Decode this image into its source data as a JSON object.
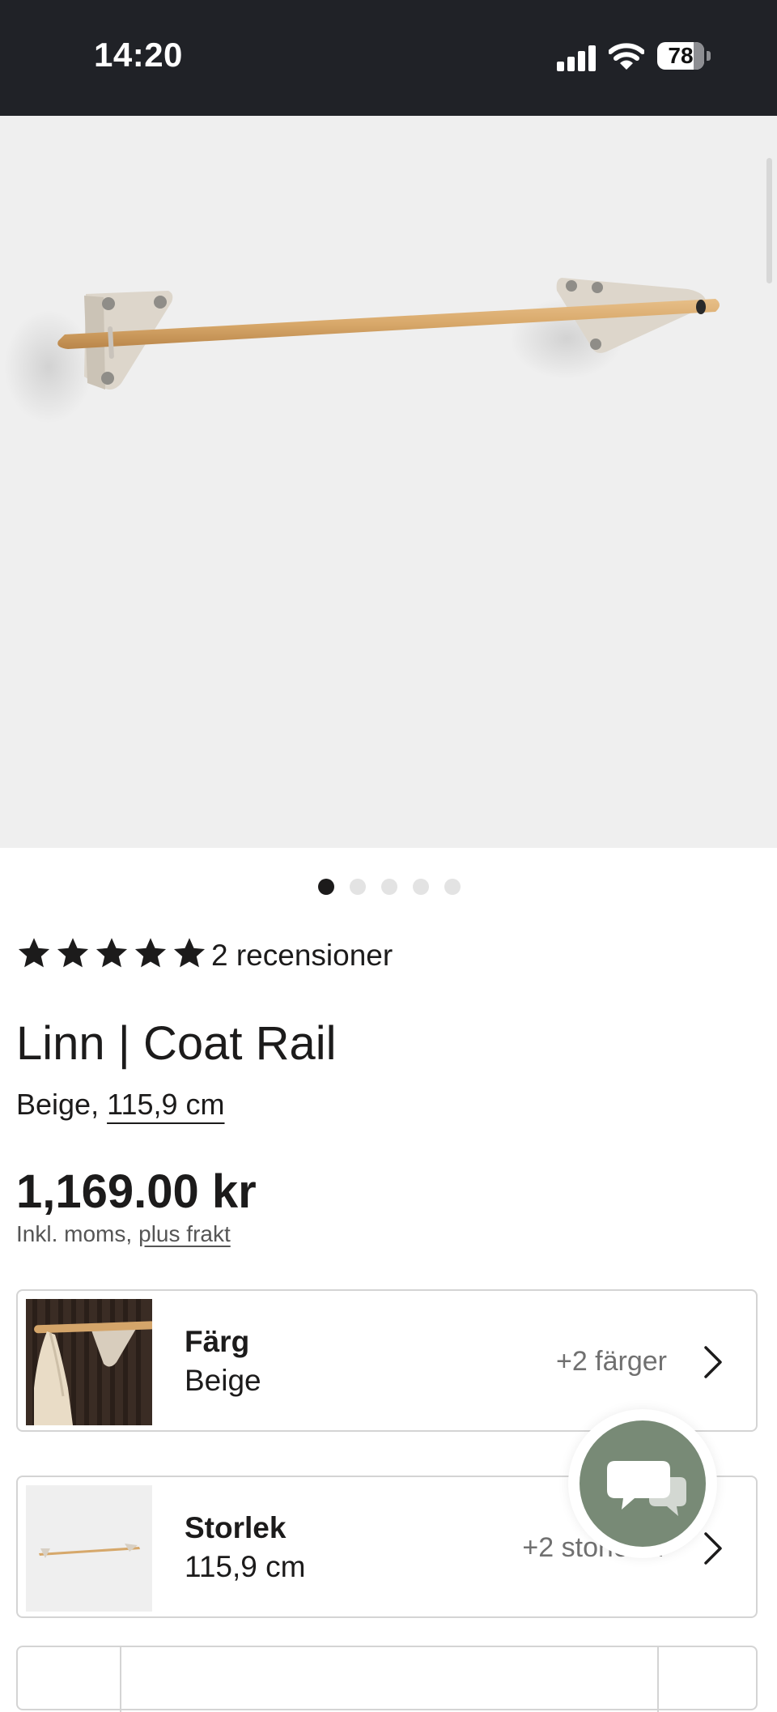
{
  "status_bar": {
    "time": "14:20",
    "battery": "78",
    "battery_level": 0.78
  },
  "gallery": {
    "image_count": 5,
    "active_index": 0
  },
  "product": {
    "rating": {
      "stars": 5,
      "reviews_label": "2 recensioner"
    },
    "title": "Linn | Coat Rail",
    "color_prefix": "Beige,",
    "size": "115,9 cm",
    "price": "1,169.00 kr",
    "price_note": "Inkl. moms,",
    "shipping_link": "plus frakt"
  },
  "options": {
    "color": {
      "label": "Färg",
      "value": "Beige",
      "more": "+2 färger"
    },
    "size": {
      "label": "Storlek",
      "value": "115,9 cm",
      "more": "+2 storlekar"
    }
  },
  "colors": {
    "status_bar_bg": "#202227",
    "text": "#1c1b1b",
    "chat_button": "#788a76",
    "card_border": "#d4d4d4"
  },
  "icons": {
    "rating": "star-icon",
    "chevron": "chevron-right-icon",
    "chat": "chat-bubbles-icon"
  }
}
